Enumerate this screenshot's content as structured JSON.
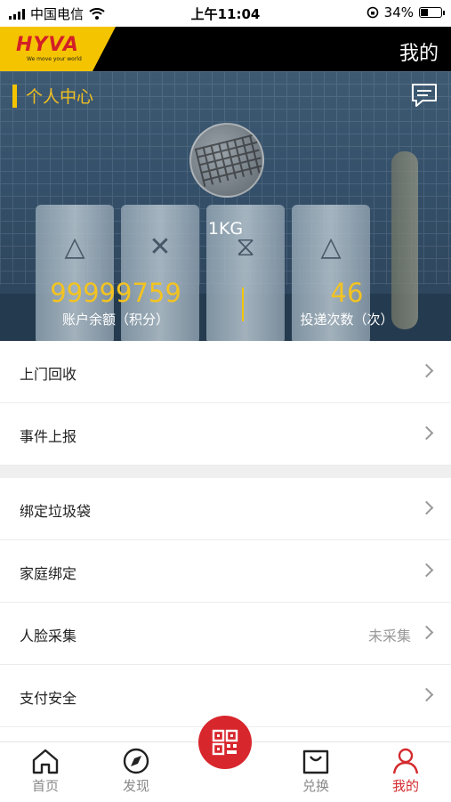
{
  "status_bar": {
    "carrier": "中国电信",
    "time": "上午11:04",
    "battery": "34%",
    "battery_level": 0.34
  },
  "header": {
    "brand": "HYVA",
    "tagline": "We move your world",
    "title": "我的"
  },
  "profile": {
    "section_title": "个人中心",
    "weight": "1KG",
    "balance_value": "99999759",
    "balance_label": "账户余额（积分）",
    "delivery_value": "46",
    "delivery_label": "投递次数（次）"
  },
  "menu_group_1": [
    {
      "label": "上门回收"
    },
    {
      "label": "事件上报"
    }
  ],
  "menu_group_2": [
    {
      "label": "绑定垃圾袋",
      "status": ""
    },
    {
      "label": "家庭绑定",
      "status": ""
    },
    {
      "label": "人脸采集",
      "status": "未采集"
    },
    {
      "label": "支付安全",
      "status": ""
    }
  ],
  "tabbar": {
    "home": "首页",
    "discover": "发现",
    "exchange": "兑换",
    "mine": "我的"
  },
  "colors": {
    "accent": "#d8262d",
    "highlight": "#f3c321",
    "header_bg": "#000000"
  }
}
